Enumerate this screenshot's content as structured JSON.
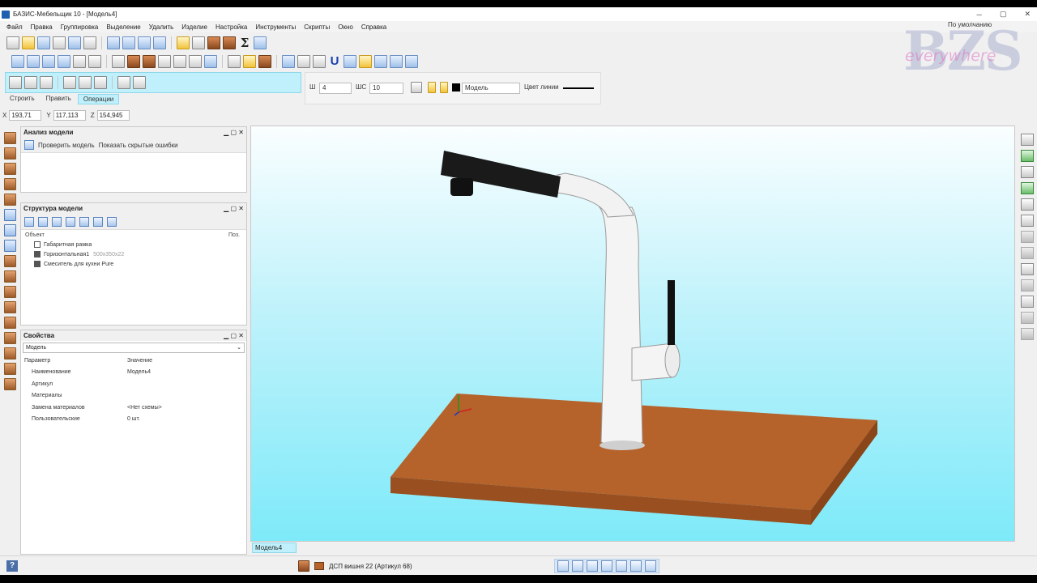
{
  "window": {
    "title": "БАЗИС-Мебельщик 10 - [Модель4]"
  },
  "menu": [
    "Файл",
    "Правка",
    "Группировка",
    "Выделение",
    "Удалить",
    "Изделие",
    "Настройка",
    "Инструменты",
    "Скрипты",
    "Окно",
    "Справка"
  ],
  "preset": "По умолчанию",
  "watermark": {
    "big": "BZS",
    "small": "everywhere"
  },
  "ops_tabs": [
    "Строить",
    "Править",
    "Операции"
  ],
  "params": {
    "w_label": "Ш",
    "w_value": "4",
    "shc_label": "ШС",
    "shc_value": "10",
    "layer_value": "Модель",
    "line_color_label": "Цвет линии"
  },
  "coords": {
    "x_label": "X",
    "x": "193,71",
    "y_label": "Y",
    "y": "117,113",
    "z_label": "Z",
    "z": "154,945"
  },
  "analysis": {
    "title": "Анализ модели",
    "check_label": "Проверить модель",
    "hidden_label": "Показать скрытые ошибки"
  },
  "structure": {
    "title": "Структура модели",
    "col_object": "Объект",
    "col_pos": "Поз.",
    "items": [
      {
        "name": "Габаритная рамка",
        "dim": ""
      },
      {
        "name": "Горизонтальная1",
        "dim": "500x350x22"
      },
      {
        "name": "Смеситель для кухни Pure",
        "dim": ""
      }
    ]
  },
  "properties": {
    "title": "Свойства",
    "selected": "Модель",
    "col_param": "Параметр",
    "col_value": "Значение",
    "rows": [
      {
        "k": "Наименование",
        "v": "Модель4"
      },
      {
        "k": "Артикул",
        "v": ""
      },
      {
        "k": "Материалы",
        "v": ""
      },
      {
        "k": "Замена материалов",
        "v": "<Нет схемы>"
      },
      {
        "k": "Пользовательские",
        "v": "0 шт."
      }
    ]
  },
  "viewport_tab": "Модель4",
  "status": {
    "material": "ДСП вишня 22 (Артикул 68)"
  },
  "panel_controls": "▁ ▢ ✕",
  "window_controls": {
    "min": "─",
    "max": "▢",
    "close": "✕"
  },
  "colors": {
    "viewport_top": "#fafeff",
    "viewport_bottom": "#7eeaf9",
    "board": "#b5622b",
    "accent": "#bff0fb"
  }
}
